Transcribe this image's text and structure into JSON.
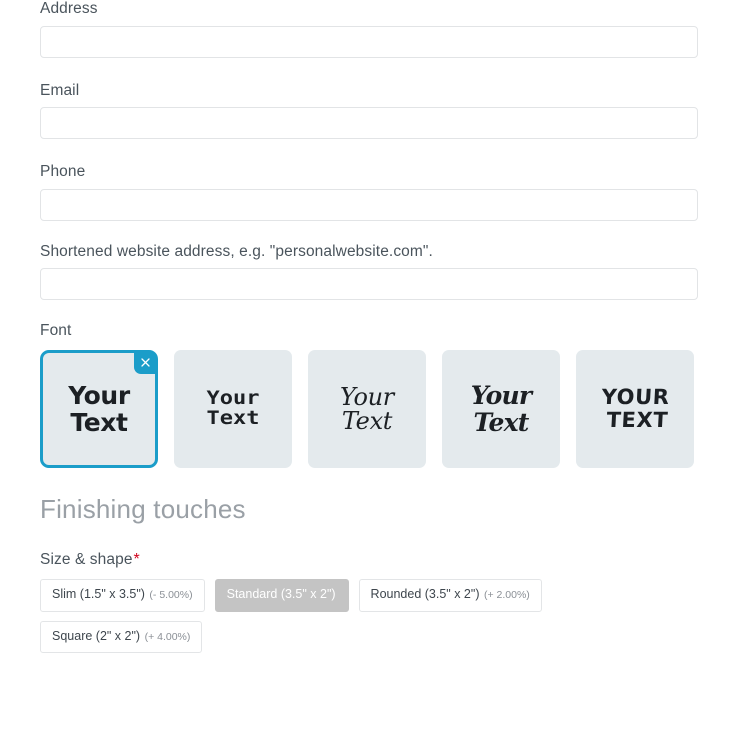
{
  "theme": {
    "label_color": "#4a545c",
    "input_border": "#e2e4e6",
    "accent": "#1b9dc9",
    "swatch_bg": "#e4eaed",
    "heading_color": "#9aa0a6",
    "selected_option_bg": "#c4c4c4",
    "required_star_color": "#d0021b"
  },
  "fields": [
    {
      "label": "Address",
      "value": "",
      "placeholder": ""
    },
    {
      "label": "Email",
      "value": "",
      "placeholder": ""
    },
    {
      "label": "Phone",
      "value": "",
      "placeholder": ""
    },
    {
      "label": "Shortened website address, e.g. \"personalwebsite.com\".",
      "value": "",
      "placeholder": ""
    }
  ],
  "font_picker": {
    "label": "Font",
    "remove_icon": "close-x-icon",
    "swatches": [
      {
        "preview_line1": "Your",
        "preview_line2": "Text",
        "style": "fs-sans",
        "name": "font-swatch-bold-sans",
        "selected": true
      },
      {
        "preview_line1": "Your",
        "preview_line2": "Text",
        "style": "fs-techno",
        "name": "font-swatch-techno",
        "selected": false
      },
      {
        "preview_line1": "Your",
        "preview_line2": "Text",
        "style": "fs-script",
        "name": "font-swatch-script",
        "selected": false
      },
      {
        "preview_line1": "Your",
        "preview_line2": "Text",
        "style": "fs-slab",
        "name": "font-swatch-bold-italic",
        "selected": false
      },
      {
        "preview_line1": "YOUR",
        "preview_line2": "TEXT",
        "style": "fs-marker",
        "name": "font-swatch-marker",
        "selected": false
      }
    ]
  },
  "finishing_touches": {
    "heading": "Finishing touches",
    "size_shape": {
      "label": "Size & shape",
      "required_marker": "*",
      "options": [
        {
          "text": "Slim (1.5\" x 3.5\")",
          "pct": "(- 5.00%)",
          "selected": false
        },
        {
          "text": "Standard (3.5\" x 2\")",
          "pct": "",
          "selected": true
        },
        {
          "text": "Rounded (3.5\" x 2\")",
          "pct": "(+ 2.00%)",
          "selected": false
        },
        {
          "text": "Square (2\" x 2\")",
          "pct": "(+ 4.00%)",
          "selected": false
        }
      ]
    }
  }
}
